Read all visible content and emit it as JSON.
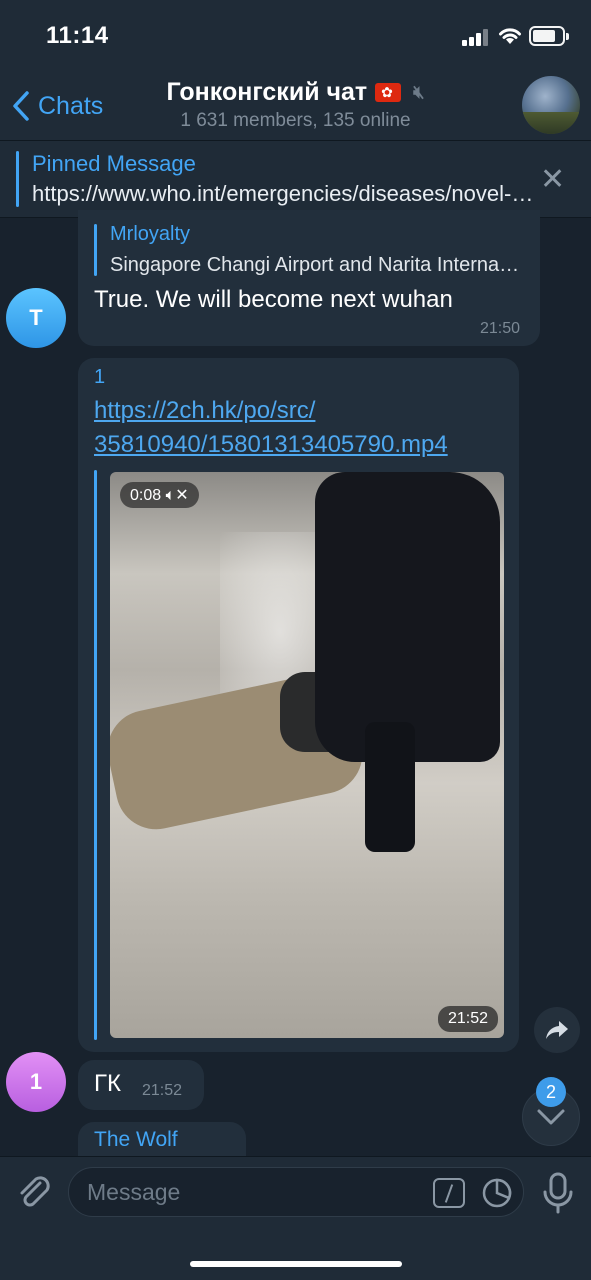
{
  "status": {
    "time": "11:14"
  },
  "header": {
    "back_label": "Chats",
    "title": "Гонконгский чат",
    "subtitle": "1 631 members, 135 online"
  },
  "pinned": {
    "title": "Pinned Message",
    "text": "https://www.who.int/emergencies/diseases/novel-coronavirus-2019"
  },
  "messages": [
    {
      "avatar_letter": "T",
      "reply_name": "Mrloyalty",
      "reply_text": "Singapore Changi Airport and Narita International Airport",
      "text": "True.  We will become next wuhan",
      "time": "21:50"
    },
    {
      "number": "1",
      "link_line1": "https://2ch.hk/po/src/",
      "link_line2": "35810940/15801313405790.mp4",
      "video_duration": "0:08",
      "time": "21:52"
    },
    {
      "avatar_letter": "1",
      "text": "ГК",
      "time": "21:52"
    },
    {
      "sender": "The Wolf"
    }
  ],
  "scroll": {
    "unread_count": "2"
  },
  "input": {
    "placeholder": "Message"
  },
  "colors": {
    "background": "#18222d",
    "bar": "#1f2b37",
    "bubble": "#222f3c",
    "accent": "#42a5f5"
  }
}
